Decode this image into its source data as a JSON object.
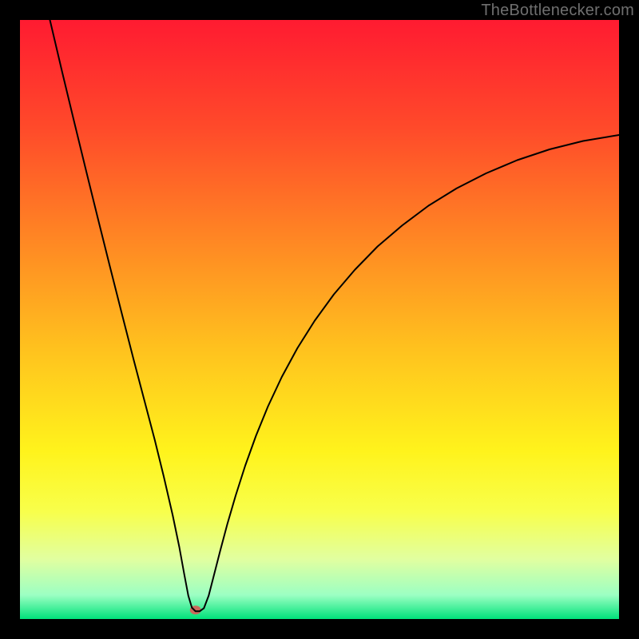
{
  "watermark": {
    "text": "TheBottlenecker.com"
  },
  "chart_data": {
    "type": "line",
    "title": "",
    "xlabel": "",
    "ylabel": "",
    "xlim": [
      0,
      100
    ],
    "ylim": [
      0,
      100
    ],
    "background_gradient": {
      "stops": [
        {
          "offset": 0.0,
          "color": "#ff1b31"
        },
        {
          "offset": 0.18,
          "color": "#ff4a2a"
        },
        {
          "offset": 0.38,
          "color": "#ff8b23"
        },
        {
          "offset": 0.55,
          "color": "#ffc21e"
        },
        {
          "offset": 0.72,
          "color": "#fff31c"
        },
        {
          "offset": 0.82,
          "color": "#f8ff4b"
        },
        {
          "offset": 0.9,
          "color": "#e1ffa0"
        },
        {
          "offset": 0.96,
          "color": "#9cffc3"
        },
        {
          "offset": 1.0,
          "color": "#00e27a"
        }
      ]
    },
    "marker": {
      "x": 29.3,
      "y": 1.5,
      "rx": 7,
      "ry": 5.5,
      "color": "#c96a5c"
    },
    "series": [
      {
        "name": "curve",
        "color": "#000000",
        "stroke_width": 2,
        "points": [
          {
            "x": 5.0,
            "y": 100.0
          },
          {
            "x": 7.0,
            "y": 91.5
          },
          {
            "x": 9.0,
            "y": 83.2
          },
          {
            "x": 11.0,
            "y": 75.0
          },
          {
            "x": 13.0,
            "y": 66.9
          },
          {
            "x": 15.0,
            "y": 58.9
          },
          {
            "x": 17.0,
            "y": 51.0
          },
          {
            "x": 19.0,
            "y": 43.2
          },
          {
            "x": 21.0,
            "y": 35.6
          },
          {
            "x": 22.5,
            "y": 29.9
          },
          {
            "x": 24.0,
            "y": 23.8
          },
          {
            "x": 25.5,
            "y": 17.3
          },
          {
            "x": 26.6,
            "y": 12.0
          },
          {
            "x": 27.4,
            "y": 7.6
          },
          {
            "x": 28.1,
            "y": 3.9
          },
          {
            "x": 28.7,
            "y": 1.9
          },
          {
            "x": 29.3,
            "y": 1.3
          },
          {
            "x": 30.0,
            "y": 1.3
          },
          {
            "x": 30.7,
            "y": 1.8
          },
          {
            "x": 31.5,
            "y": 3.9
          },
          {
            "x": 32.4,
            "y": 7.4
          },
          {
            "x": 33.4,
            "y": 11.3
          },
          {
            "x": 34.6,
            "y": 15.8
          },
          {
            "x": 36.0,
            "y": 20.6
          },
          {
            "x": 37.6,
            "y": 25.6
          },
          {
            "x": 39.4,
            "y": 30.6
          },
          {
            "x": 41.4,
            "y": 35.5
          },
          {
            "x": 43.7,
            "y": 40.4
          },
          {
            "x": 46.3,
            "y": 45.2
          },
          {
            "x": 49.2,
            "y": 49.8
          },
          {
            "x": 52.4,
            "y": 54.2
          },
          {
            "x": 55.9,
            "y": 58.3
          },
          {
            "x": 59.7,
            "y": 62.2
          },
          {
            "x": 63.8,
            "y": 65.7
          },
          {
            "x": 68.2,
            "y": 69.0
          },
          {
            "x": 72.9,
            "y": 71.9
          },
          {
            "x": 77.8,
            "y": 74.4
          },
          {
            "x": 83.0,
            "y": 76.6
          },
          {
            "x": 88.4,
            "y": 78.4
          },
          {
            "x": 94.0,
            "y": 79.8
          },
          {
            "x": 100.0,
            "y": 80.8
          }
        ]
      }
    ]
  }
}
